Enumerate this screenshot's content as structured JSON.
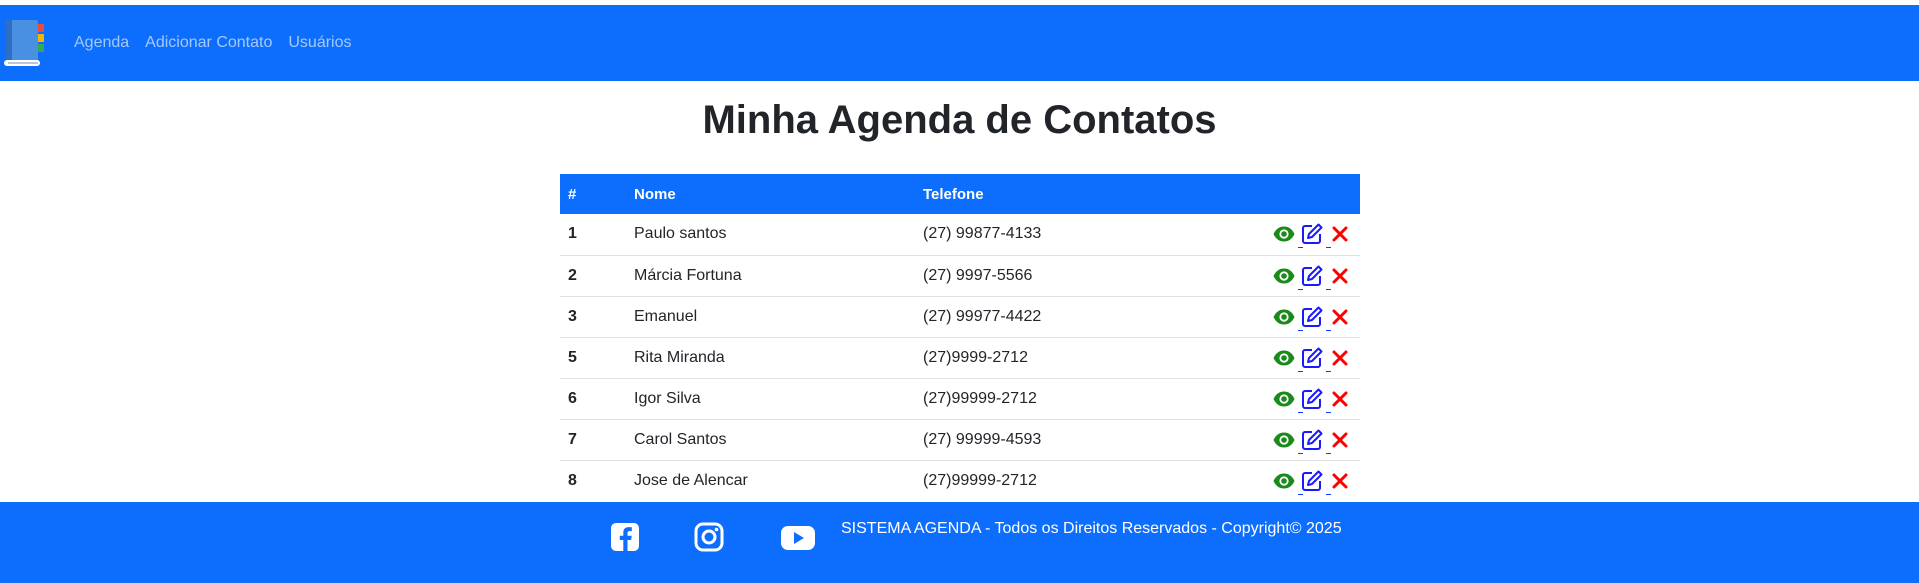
{
  "navbar": {
    "logo_icon": "address-book-icon",
    "links": [
      {
        "label": "Agenda"
      },
      {
        "label": "Adicionar Contato"
      },
      {
        "label": "Usuários"
      }
    ]
  },
  "main": {
    "title": "Minha Agenda de Contatos",
    "table": {
      "headers": [
        "#",
        "Nome",
        "Telefone",
        ""
      ],
      "rows": [
        {
          "id": "1",
          "name": "Paulo santos",
          "phone": "(27) 99877-4133"
        },
        {
          "id": "2",
          "name": "Márcia Fortuna",
          "phone": "(27) 9997-5566"
        },
        {
          "id": "3",
          "name": "Emanuel",
          "phone": "(27) 99977-4422"
        },
        {
          "id": "5",
          "name": "Rita Miranda",
          "phone": "(27)9999-2712"
        },
        {
          "id": "6",
          "name": "Igor Silva",
          "phone": "(27)99999-2712"
        },
        {
          "id": "7",
          "name": "Carol Santos",
          "phone": "(27) 99999-4593"
        },
        {
          "id": "8",
          "name": "Jose de Alencar",
          "phone": "(27)99999-2712"
        }
      ],
      "row_actions": [
        "eye-icon",
        "edit-icon",
        "close-icon"
      ]
    }
  },
  "footer": {
    "social": [
      "facebook-icon",
      "instagram-icon",
      "youtube-icon"
    ],
    "text": "SISTEMA AGENDA - Todos os Direitos Reservados - Copyright© 2025"
  },
  "colors": {
    "primary": "#0d6efd",
    "view": "#1a8a1a",
    "edit": "#1a1aff",
    "delete": "#ff0000"
  }
}
